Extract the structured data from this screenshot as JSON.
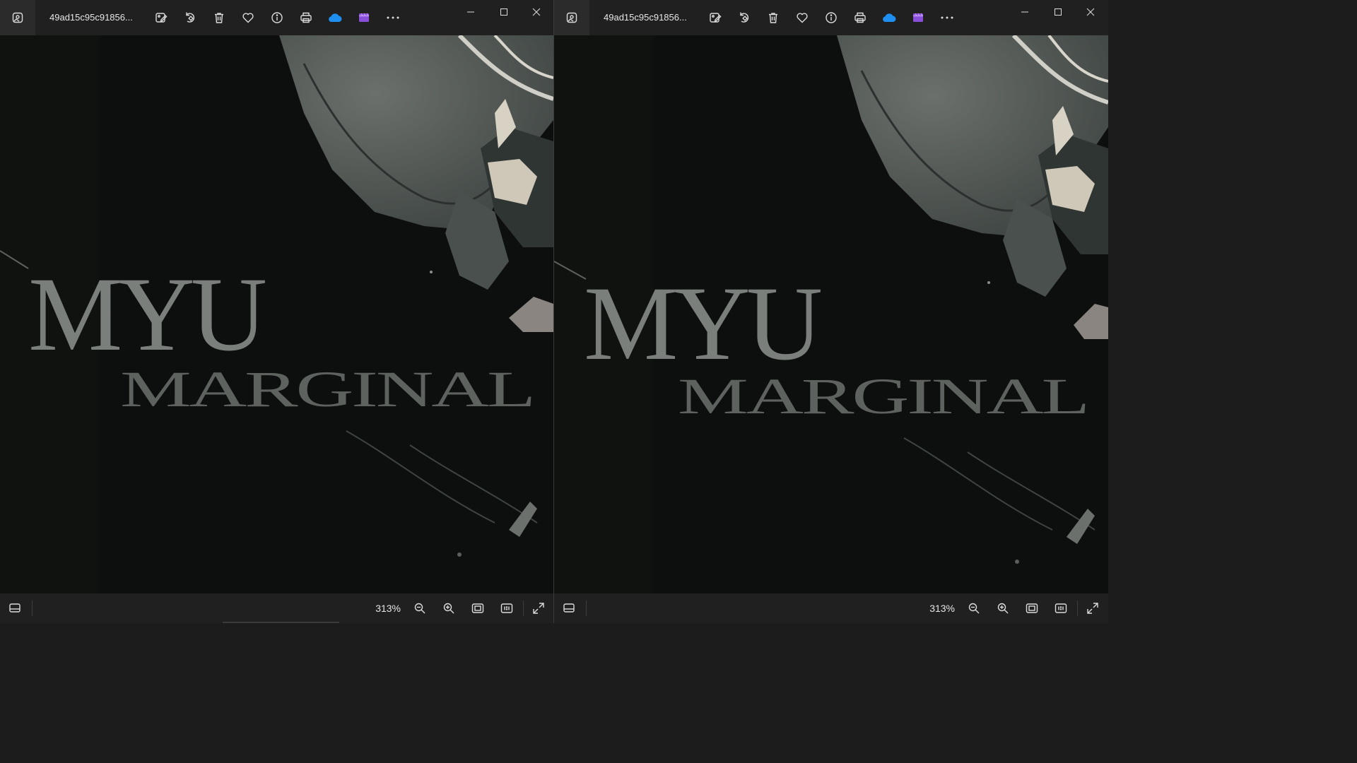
{
  "windows": [
    {
      "id": "left",
      "filename": "49ad15c95c91856...",
      "zoom": "313%",
      "artwork_text": {
        "line1": "MYU",
        "line2": "MARGINAL"
      }
    },
    {
      "id": "right",
      "filename": "49ad15c95c91856...",
      "zoom": "313%",
      "artwork_text": {
        "line1": "MYU",
        "line2": "MARGINAL"
      }
    }
  ],
  "toolbar_icons": [
    "photos-app-icon",
    "edit-image-icon",
    "rotate-icon",
    "delete-icon",
    "favorite-icon",
    "info-icon",
    "print-icon",
    "onedrive-icon",
    "clipchamp-icon",
    "more-icon"
  ],
  "colors": {
    "onedrive": "#1f8ef1",
    "clipchamp": "#8a4fd8",
    "canvas": "#0d0f0e",
    "chrome": "#202020"
  }
}
